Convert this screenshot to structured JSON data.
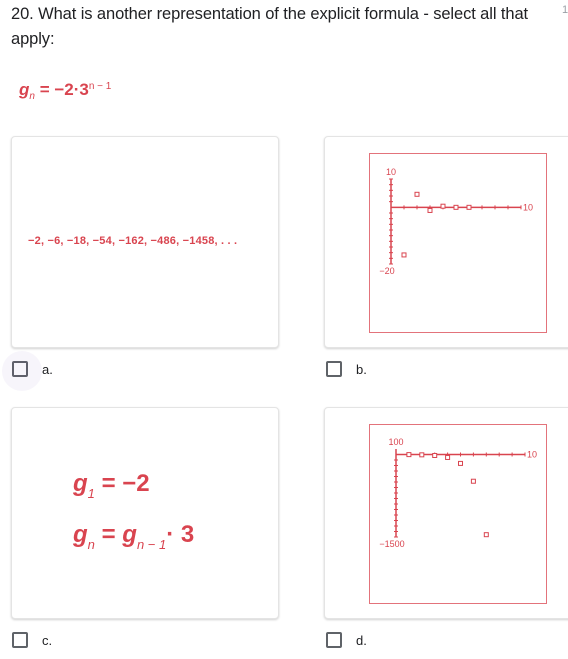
{
  "question": {
    "text": "20. What is another representation of the explicit formula - select all that apply:",
    "points_fragment": "1"
  },
  "formula": {
    "lhs_var": "g",
    "lhs_sub": "n",
    "rhs": "= −2·3",
    "exp": "n − 1"
  },
  "options": [
    {
      "id": "a",
      "label": "a.",
      "checked": false,
      "content": "−2, −6, −18, −54, −162, −486, −1458, . . ."
    },
    {
      "id": "b",
      "label": "b.",
      "checked": false
    },
    {
      "id": "c",
      "label": "c.",
      "checked": false,
      "line1": {
        "var": "g",
        "sub": "1",
        "rhs": " = −2"
      },
      "line2": {
        "var": "g",
        "sub": "n",
        "eq": " = ",
        "var2": "g",
        "sub2": "n − 1",
        "rhs": "· 3"
      }
    },
    {
      "id": "d",
      "label": "d.",
      "checked": false
    }
  ],
  "colors": {
    "accent": "#d9444f",
    "text": "#202124",
    "checkbox": "#5f6368"
  },
  "chart_data": [
    {
      "id": "option-b-graph",
      "type": "scatter",
      "title": "",
      "xlabel": "",
      "ylabel": "",
      "xlim": [
        0,
        10
      ],
      "ylim": [
        -20,
        10
      ],
      "x_tick_labels": [
        "10"
      ],
      "y_tick_labels": [
        "10",
        "−20"
      ],
      "x_ticks": [
        1,
        2,
        3,
        4,
        5,
        6,
        7,
        8,
        9,
        10
      ],
      "y_ticks": [
        10,
        8,
        6,
        4,
        2,
        -2,
        -4,
        -6,
        -8,
        -10,
        -12,
        -14,
        -16,
        -18,
        -20
      ],
      "grid": false,
      "x": [
        1,
        2,
        3,
        4,
        5,
        6
      ],
      "y": [
        -16.8,
        4.6,
        -1.1,
        0.4,
        0.0,
        0.0
      ]
    },
    {
      "id": "option-d-graph",
      "type": "scatter",
      "title": "",
      "xlabel": "",
      "ylabel": "",
      "xlim": [
        0,
        10
      ],
      "ylim": [
        -1500,
        100
      ],
      "x_tick_labels": [
        "10"
      ],
      "y_tick_labels": [
        "100",
        "−1500"
      ],
      "x_ticks": [
        1,
        2,
        3,
        4,
        5,
        6,
        7,
        8,
        9,
        10
      ],
      "y_ticks": [
        -100,
        -200,
        -300,
        -400,
        -500,
        -600,
        -700,
        -800,
        -900,
        -1000,
        -1100,
        -1200,
        -1300,
        -1400,
        -1500
      ],
      "grid": false,
      "x": [
        1,
        2,
        3,
        4,
        5,
        6,
        7
      ],
      "y": [
        -2,
        -6,
        -18,
        -54,
        -162,
        -486,
        -1458
      ]
    }
  ]
}
